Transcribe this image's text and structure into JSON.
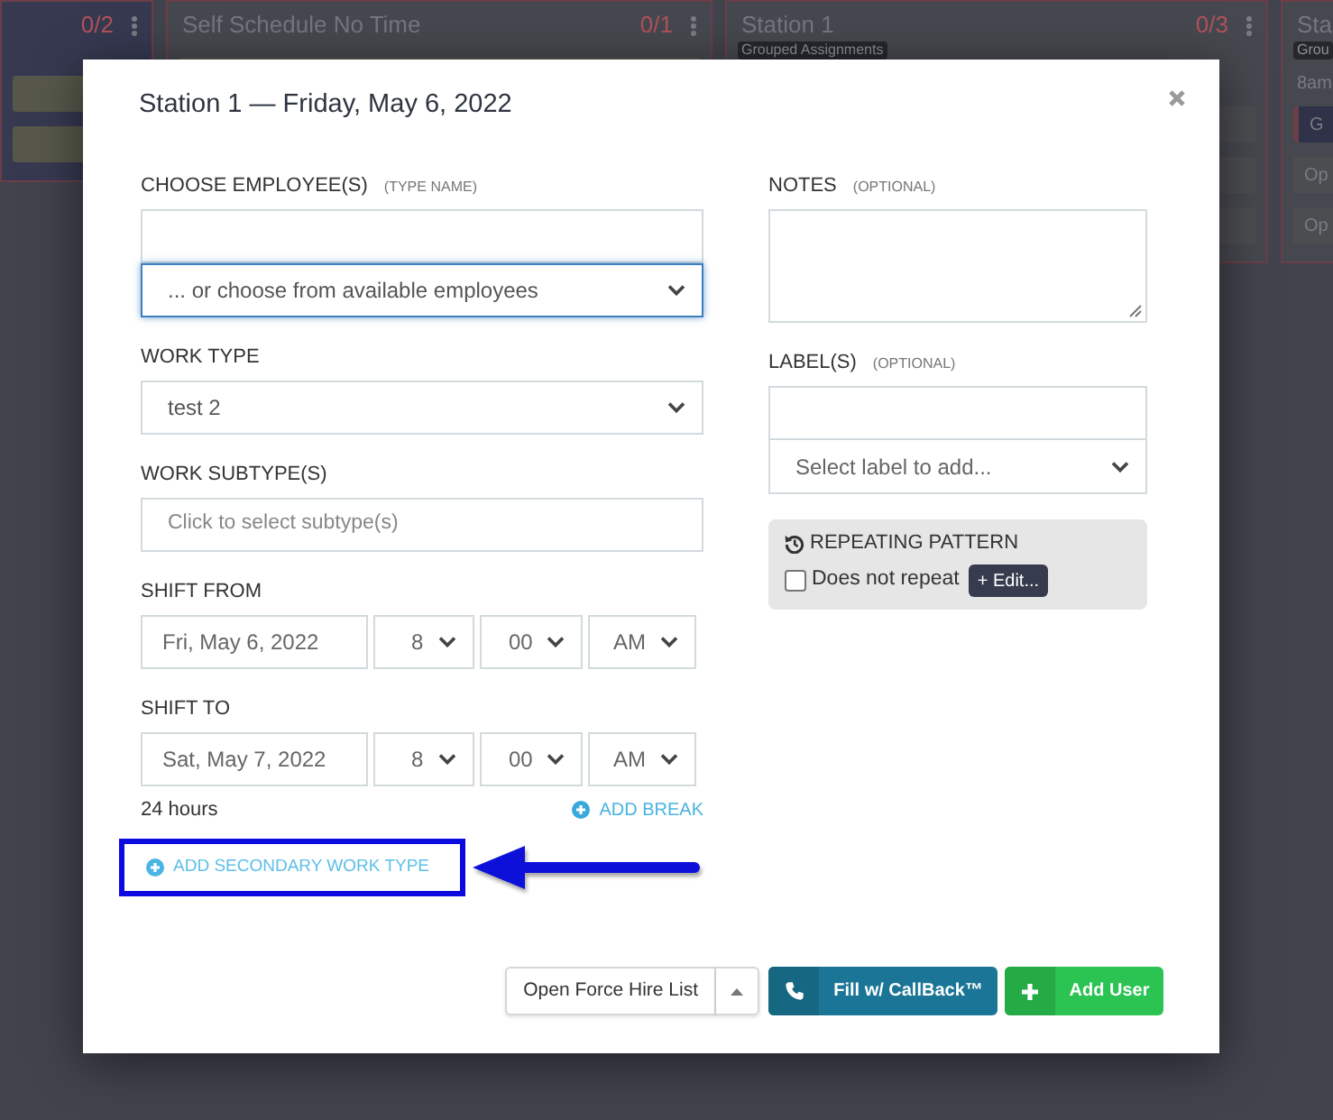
{
  "board": {
    "columns": [
      {
        "highlighted": true,
        "count": "0/2",
        "items": [
          {
            "kind": "open"
          },
          {
            "kind": "open"
          }
        ]
      },
      {
        "highlighted": false,
        "title": "Self Schedule No Time",
        "count": "0/1",
        "items": [
          {
            "kind": "open"
          }
        ]
      },
      {
        "highlighted": false,
        "title": "Station 1",
        "count": "0/3",
        "badge": "Grouped Assignments",
        "items": [
          {
            "kind": "shift"
          },
          {
            "kind": "shift"
          },
          {
            "kind": "shift"
          }
        ]
      },
      {
        "highlighted": false,
        "title": "Sta",
        "badge": "Grou",
        "time": "8am",
        "items": [
          {
            "kind": "button",
            "text": "G"
          },
          {
            "kind": "shift",
            "text": "Op"
          },
          {
            "kind": "shift",
            "text": "Op"
          }
        ]
      }
    ]
  },
  "dialog": {
    "title": "Station 1 — Friday, May 6, 2022",
    "employees": {
      "label": "CHOOSE EMPLOYEE(S)",
      "hint": "(TYPE NAME)",
      "choose": "... or choose from available employees",
      "focused": true
    },
    "work_type": {
      "label": "WORK TYPE",
      "value": "test 2"
    },
    "work_subtype": {
      "label": "WORK SUBTYPE(S)",
      "placeholder": "Click to select subtype(s)"
    },
    "shift_from": {
      "label": "SHIFT FROM",
      "date": "Fri, May 6, 2022",
      "hour": "8",
      "minute": "00",
      "period": "AM"
    },
    "shift_to": {
      "label": "SHIFT TO",
      "date": "Sat, May 7, 2022",
      "hour": "8",
      "minute": "00",
      "period": "AM"
    },
    "duration": "24 hours",
    "add_break": "ADD BREAK",
    "add_secondary": {
      "label": "ADD SECONDARY WORK TYPE",
      "highlighted": true
    },
    "notes": {
      "label": "NOTES",
      "hint": "(OPTIONAL)"
    },
    "labels": {
      "label": "LABEL(S)",
      "hint": "(OPTIONAL)",
      "choose": "Select label to add..."
    },
    "repeating": {
      "title": "REPEATING PATTERN",
      "checkbox": {
        "label": "Does not repeat",
        "checked": false
      },
      "edit": "+ Edit..."
    },
    "footer": [
      {
        "kind": "dropdown",
        "label": "Open Force Hire List"
      },
      {
        "kind": "callback",
        "label": "Fill w/ CallBack™"
      },
      {
        "kind": "add",
        "label": "Add User"
      }
    ]
  }
}
